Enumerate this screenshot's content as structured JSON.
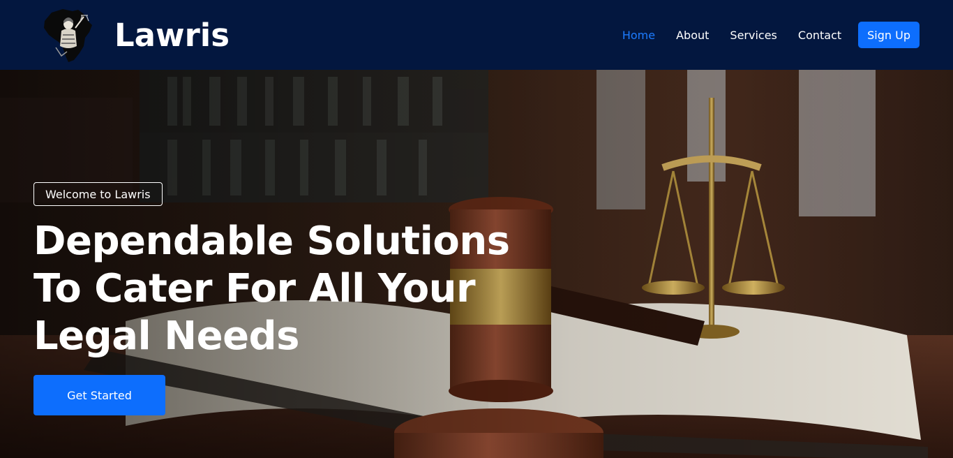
{
  "brand": {
    "name": "Lawris",
    "logo_icon": "lady-justice-africa-logo"
  },
  "nav": {
    "items": [
      {
        "label": "Home",
        "active": true
      },
      {
        "label": "About",
        "active": false
      },
      {
        "label": "Services",
        "active": false
      },
      {
        "label": "Contact",
        "active": false
      }
    ],
    "signup_label": "Sign Up"
  },
  "hero": {
    "badge": "Welcome to Lawris",
    "headline": "Dependable Solutions To Cater For All Your Legal Needs",
    "cta_label": "Get Started",
    "background": "gavel-book-scales-photo"
  },
  "colors": {
    "navbar_bg": "#03173f",
    "accent": "#0d6efd",
    "active_link": "#1d7cff",
    "text": "#ffffff"
  }
}
